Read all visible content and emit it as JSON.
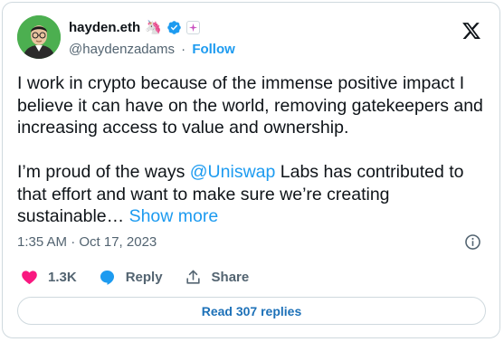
{
  "author": {
    "name": "hayden.eth",
    "name_emoji": "🦄",
    "handle": "@haydenzadams",
    "separator": "·",
    "follow_label": "Follow",
    "verified_color": "#1d9bf0",
    "badge_icon": "spark-badge-icon"
  },
  "tweet": {
    "paragraph1": "I work in crypto because of the immense positive impact I believe it can have on the world, removing gatekeepers and increasing access to value and ownership.",
    "p2_before": "I’m proud of the ways ",
    "p2_mention": "@Uniswap",
    "p2_after": " Labs has contributed to that effort and want to make sure we’re creating sustainable… ",
    "show_more": "Show more",
    "timestamp": "1:35 AM · Oct 17, 2023"
  },
  "actions": {
    "like_count": "1.3K",
    "reply_label": "Reply",
    "share_label": "Share",
    "like_color": "#f91880",
    "reply_color": "#1d9bf0"
  },
  "footer": {
    "read_replies": "Read 307 replies"
  },
  "colors": {
    "accent": "#1d9bf0",
    "secondary_text": "#536471",
    "border": "#cfd9de"
  }
}
